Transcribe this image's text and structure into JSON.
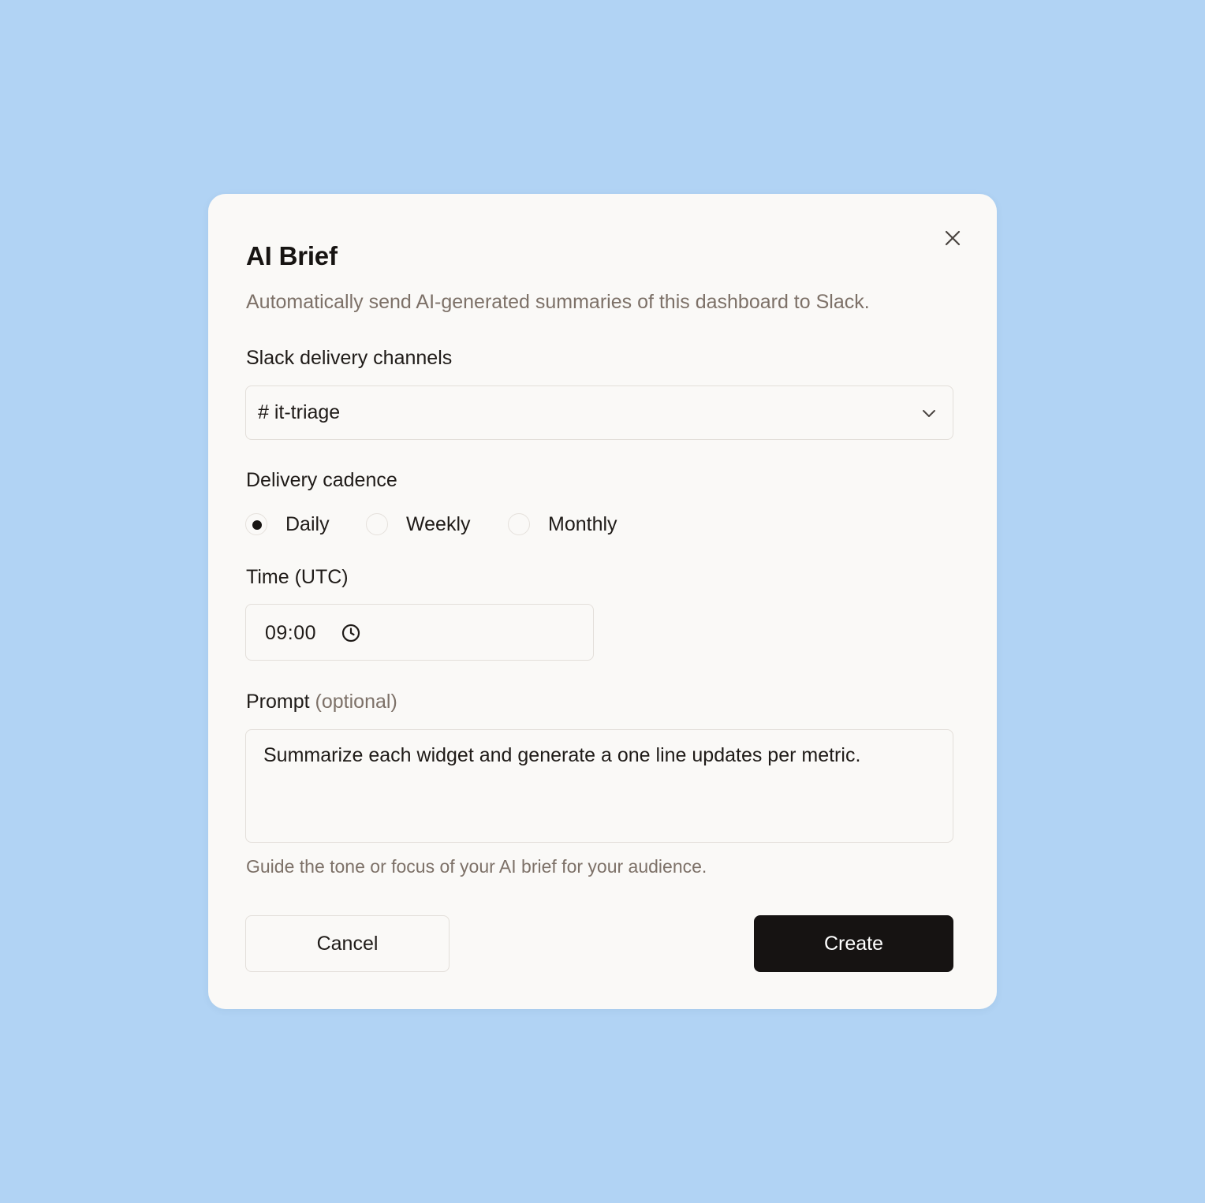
{
  "modal": {
    "title": "AI Brief",
    "subtitle": "Automatically send AI-generated summaries of this dashboard to Slack.",
    "close_icon": "close-icon"
  },
  "channels": {
    "label": "Slack delivery channels",
    "value": "# it-triage",
    "icon": "chevron-down-icon"
  },
  "cadence": {
    "label": "Delivery cadence",
    "options": [
      "Daily",
      "Weekly",
      "Monthly"
    ],
    "selected": "Daily"
  },
  "time": {
    "label": "Time (UTC)",
    "value": "09:00",
    "icon": "clock-icon"
  },
  "prompt": {
    "label": "Prompt",
    "optional_label": "(optional)",
    "value": "Summarize each widget and generate a one line updates per metric.",
    "help": "Guide the tone or focus of your AI brief for your audience."
  },
  "actions": {
    "cancel_label": "Cancel",
    "create_label": "Create"
  },
  "colors": {
    "background": "#b1d3f4",
    "modal": "#faf9f7",
    "primary": "#161312",
    "muted_text": "#7d7168"
  }
}
